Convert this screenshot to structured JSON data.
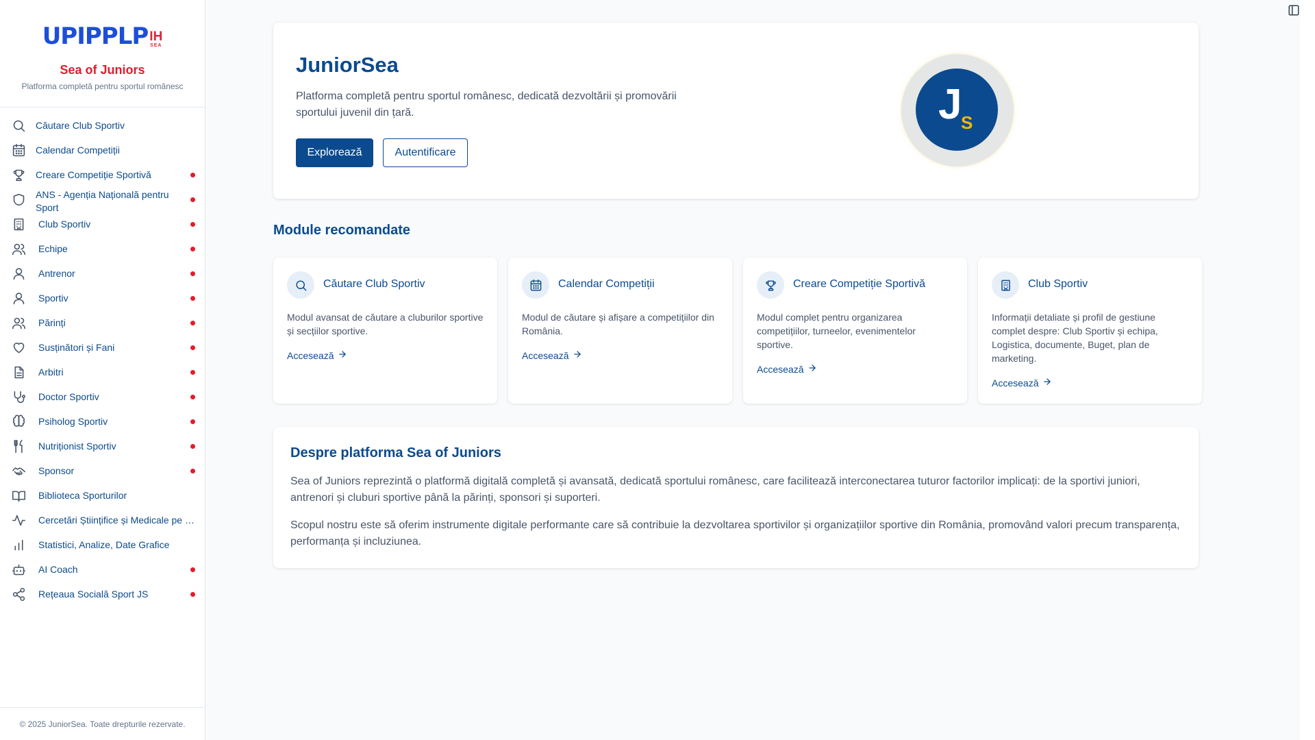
{
  "brand": {
    "logo_main": "UPIPPLP",
    "logo_ih": "IH",
    "logo_sea": "SEA",
    "title": "Sea of Juniors",
    "subtitle": "Platforma completă pentru sportul românesc"
  },
  "sidebar": {
    "items": [
      {
        "label": "Căutare Club Sportiv",
        "icon": "search-icon",
        "dot": false
      },
      {
        "label": "Calendar Competiții",
        "icon": "calendar-icon",
        "dot": false
      },
      {
        "label": "Creare Competiție Sportivă",
        "icon": "trophy-icon",
        "dot": true
      },
      {
        "label": "ANS - Agenția Națională pentru Sport",
        "icon": "shield-icon",
        "dot": true
      },
      {
        "label": "Club Sportiv",
        "icon": "building-icon",
        "dot": true
      },
      {
        "label": "Echipe",
        "icon": "users-icon",
        "dot": true
      },
      {
        "label": "Antrenor",
        "icon": "user-icon",
        "dot": true
      },
      {
        "label": "Sportiv",
        "icon": "user-icon",
        "dot": true
      },
      {
        "label": "Părinți",
        "icon": "users-icon",
        "dot": true
      },
      {
        "label": "Susținători și Fani",
        "icon": "heart-icon",
        "dot": true
      },
      {
        "label": "Arbitri",
        "icon": "document-icon",
        "dot": true
      },
      {
        "label": "Doctor Sportiv",
        "icon": "stethoscope-icon",
        "dot": true
      },
      {
        "label": "Psiholog Sportiv",
        "icon": "brain-icon",
        "dot": true
      },
      {
        "label": "Nutriționist Sportiv",
        "icon": "utensils-icon",
        "dot": true
      },
      {
        "label": "Sponsor",
        "icon": "handshake-icon",
        "dot": true
      },
      {
        "label": "Biblioteca Sporturilor",
        "icon": "book-icon",
        "dot": false
      },
      {
        "label": "Cercetări Științifice și Medicale pe …",
        "icon": "activity-icon",
        "dot": false
      },
      {
        "label": "Statistici, Analize, Date Grafice",
        "icon": "bar-chart-icon",
        "dot": false
      },
      {
        "label": "AI Coach",
        "icon": "bot-icon",
        "dot": true
      },
      {
        "label": "Rețeaua Socială Sport JS",
        "icon": "share-icon",
        "dot": true
      }
    ],
    "footer": "© 2025 JuniorSea. Toate drepturile rezervate."
  },
  "hero": {
    "title": "JuniorSea",
    "description": "Platforma completă pentru sportul românesc, dedicată dezvoltării și promovării sportului juvenil din țară.",
    "explore_label": "Explorează",
    "login_label": "Autentificare",
    "avatar_letter": "J",
    "avatar_sub": "S"
  },
  "modules": {
    "heading": "Module recomandate",
    "cards": [
      {
        "title": "Căutare Club Sportiv",
        "icon": "search-icon",
        "description": "Modul avansat de căutare a cluburilor sportive și secțiilor sportive.",
        "link": "Accesează"
      },
      {
        "title": "Calendar Competiții",
        "icon": "calendar-icon",
        "description": "Modul de căutare și afișare a competițiilor din România.",
        "link": "Accesează"
      },
      {
        "title": "Creare Competiție Sportivă",
        "icon": "trophy-icon",
        "description": "Modul complet pentru organizarea competițiilor, turneelor, evenimentelor sportive.",
        "link": "Accesează"
      },
      {
        "title": "Club Sportiv",
        "icon": "building-icon",
        "description": "Informații detaliate și profil de gestiune complet despre: Club Sportiv și echipa, Logistica, documente, Buget, plan de marketing.",
        "link": "Accesează"
      }
    ]
  },
  "about": {
    "title": "Despre platforma Sea of Juniors",
    "p1": "Sea of Juniors reprezintă o platformă digitală completă și avansată, dedicată sportului românesc, care facilitează interconectarea tuturor factorilor implicați: de la sportivi juniori, antrenori și cluburi sportive până la părinți, sponsori și suporteri.",
    "p2": "Scopul nostru este să oferim instrumente digitale performante care să contribuie la dezvoltarea sportivilor și organizațiilor sportive din România, promovând valori precum transparența, performanța și incluziunea."
  },
  "colors": {
    "primary": "#0b4a8f",
    "accent_red": "#dc1e2f",
    "dot_red": "#e11d2a",
    "avatar_gold": "#f0b90b"
  }
}
